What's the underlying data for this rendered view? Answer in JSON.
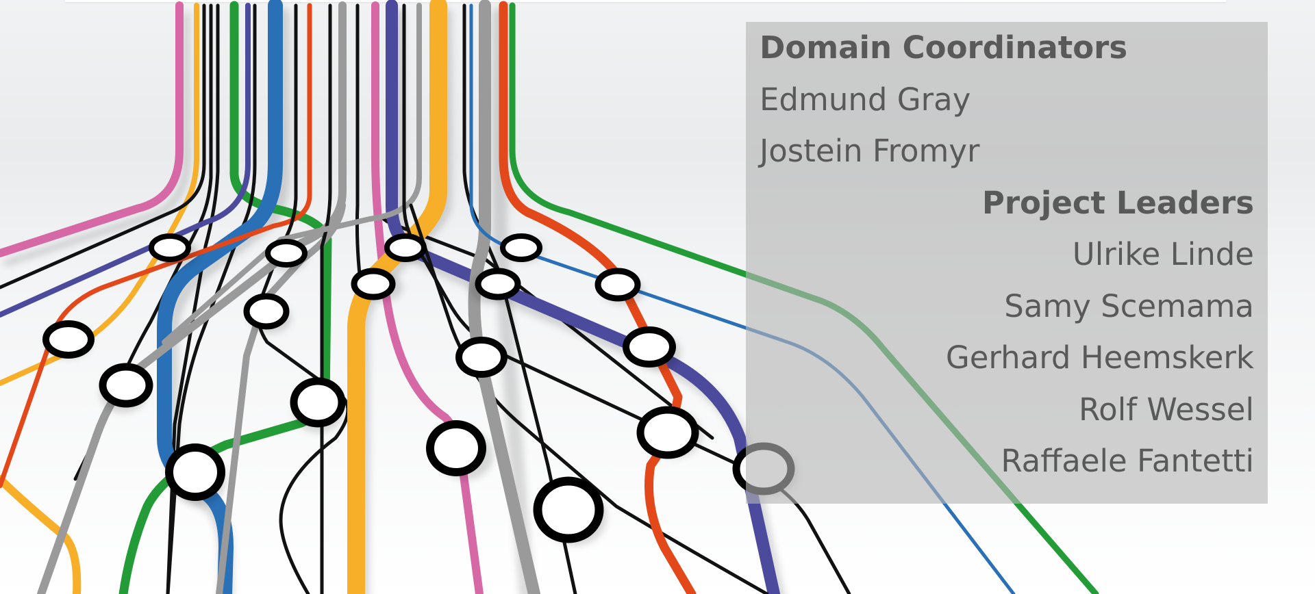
{
  "panel": {
    "domain_coordinators_title": "Domain Coordinators",
    "domain_coordinators": [
      "Edmund Gray",
      "Jostein Fromyr"
    ],
    "project_leaders_title": "Project Leaders",
    "project_leaders": [
      "Ulrike Linde",
      "Samy Scemama",
      "Gerhard Heemskerk",
      "Rolf Wessel",
      "Raffaele Fantetti"
    ]
  },
  "colors": {
    "pink": "#d668a6",
    "orange": "#f7ae28",
    "green": "#239b37",
    "blue": "#2a70b7",
    "purple": "#4b4a9c",
    "red": "#e24819",
    "gray": "#9a9a9a",
    "black": "#111111",
    "panel": "#b4b4b4",
    "text": "#595959"
  }
}
